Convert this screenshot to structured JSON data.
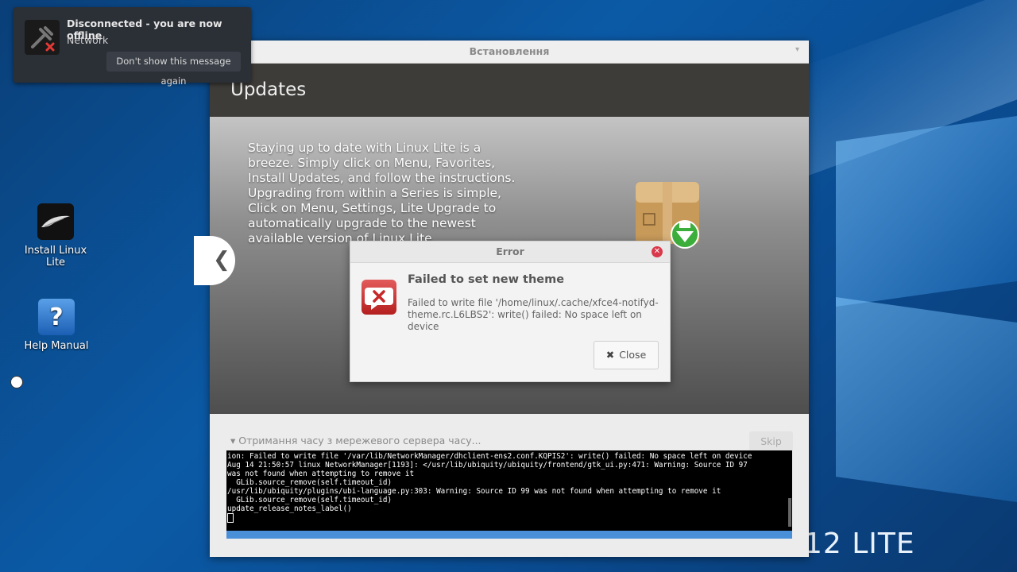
{
  "notification": {
    "title": "Disconnected - you are now offline",
    "subtitle": "Network",
    "dismiss_label": "Don't show this message again"
  },
  "desktop": {
    "icons": [
      {
        "label": "Install Linux Lite",
        "icon": "linux-lite-feather-icon"
      },
      {
        "label": "Help Manual",
        "icon": "help-question-icon"
      }
    ],
    "brand_text": "12 LITE"
  },
  "installer": {
    "window_title": "Встановлення",
    "page_title": "Updates",
    "slide_text": "Staying up to date with Linux Lite is a breeze. Simply click on Menu, Favorites, Install Updates, and follow the instructions. Upgrading from within a Series is simple, Click on Menu, Settings, Lite Upgrade to automatically upgrade to the newest available version of Linux Lite.",
    "prev_arrow": "❮",
    "status_label": "Отримання часу з мережевого сервера часу...",
    "skip_label": "Skip",
    "terminal_lines": [
      "ion: Failed to write file '/var/lib/NetworkManager/dhclient-ens2.conf.KQPIS2': write() failed: No space left on device",
      "Aug 14 21:50:57 linux NetworkManager[1193]: </usr/lib/ubiquity/ubiquity/frontend/gtk_ui.py:471: Warning: Source ID 97",
      "was not found when attempting to remove it",
      "  GLib.source_remove(self.timeout_id)",
      "/usr/lib/ubiquity/plugins/ubi-language.py:303: Warning: Source ID 99 was not found when attempting to remove it",
      "  GLib.source_remove(self.timeout_id)",
      "update_release_notes_label()"
    ]
  },
  "error_dialog": {
    "title": "Error",
    "heading": "Failed to set new theme",
    "message": "Failed to write file '/home/linux/.cache/xfce4-notifyd-theme.rc.L6LBS2': write() failed: No space left on device",
    "close_label": "Close"
  }
}
